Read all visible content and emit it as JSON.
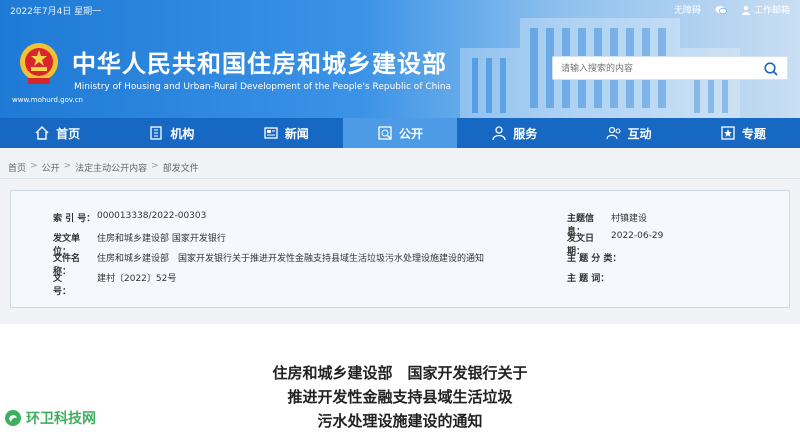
{
  "header": {
    "date": "2022年7月4日 星期一",
    "top_links": {
      "accessibility": "无障碍",
      "mail": "工作邮箱"
    },
    "title_cn": "中华人民共和国住房和城乡建设部",
    "title_en": "Ministry of Housing and Urban-Rural Development of the People's Republic of China",
    "site_url": "www.mohurd.gov.cn",
    "search_placeholder": "请输入搜索的内容"
  },
  "nav": {
    "items": [
      {
        "label": "首页",
        "icon": "home-icon"
      },
      {
        "label": "机构",
        "icon": "building-icon"
      },
      {
        "label": "新闻",
        "icon": "news-icon"
      },
      {
        "label": "公开",
        "icon": "public-icon",
        "active": true
      },
      {
        "label": "服务",
        "icon": "service-icon"
      },
      {
        "label": "互动",
        "icon": "interact-icon"
      },
      {
        "label": "专题",
        "icon": "topic-icon"
      }
    ]
  },
  "breadcrumb": [
    "首页",
    "公开",
    "法定主动公开内容",
    "部发文件"
  ],
  "breadcrumb_sep": ">",
  "info": {
    "index_label": "索 引 号：",
    "index_value": "000013338/2022-00303",
    "issuer_label": "发文单位：",
    "issuer_value": "住房和城乡建设部 国家开发银行",
    "name_label": "文件名称：",
    "name_value": "住房和城乡建设部　国家开发银行关于推进开发性金融支持县域生活垃圾污水处理设施建设的通知",
    "docno_label": "文　　号：",
    "docno_value": "建村〔2022〕52号",
    "topic_label": "主题信息：",
    "topic_value": "村镇建设",
    "date_label": "发文日期：",
    "date_value": "2022-06-29",
    "category_label": "主 题 分 类：",
    "category_value": "",
    "keywords_label": "主 题 词：",
    "keywords_value": ""
  },
  "article": {
    "title_lines": [
      "住房和城乡建设部　国家开发银行关于",
      "推进开发性金融支持县域生活垃圾",
      "污水处理设施建设的通知"
    ]
  },
  "watermark": "环卫科技网",
  "colors": {
    "nav_bg": "#1768c2",
    "nav_active": "#4d9be6",
    "header_blue": "#1f7ad6"
  }
}
